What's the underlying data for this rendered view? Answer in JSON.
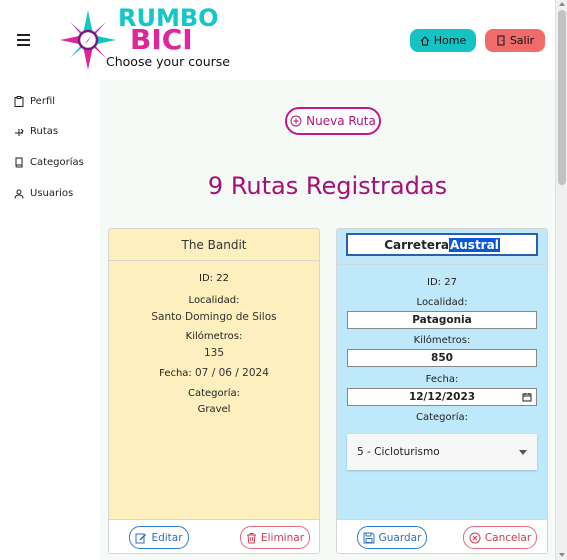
{
  "header": {
    "logo": {
      "word1": "RUMBO",
      "word2": "BICI",
      "tagline": "Choose your course"
    },
    "home_label": "Home",
    "salir_label": "Salir"
  },
  "sidebar": {
    "items": [
      {
        "label": "Perfil",
        "icon": "clipboard-icon"
      },
      {
        "label": "Rutas",
        "icon": "route-icon"
      },
      {
        "label": "Categorías",
        "icon": "book-icon"
      },
      {
        "label": "Usuarios",
        "icon": "user-icon"
      }
    ]
  },
  "main": {
    "new_route_label": "Nueva Ruta",
    "title": "9 Rutas Registradas"
  },
  "cards": [
    {
      "title": "The Bandit",
      "id_text": "ID: 22",
      "localidad_label": "Localidad:",
      "localidad": "Santo Domingo de Silos",
      "km_label": "Kilómetros:",
      "km": "135",
      "fecha_label": "Fecha:",
      "fecha": "07 / 06 / 2024",
      "categoria_label": "Categoría:",
      "categoria": "Gravel",
      "edit_label": "Editar",
      "delete_label": "Eliminar"
    },
    {
      "title_part1": "Carretera ",
      "title_part2": "Austral",
      "id_text": "ID: 27",
      "localidad_label": "Localidad:",
      "localidad": "Patagonia",
      "km_label": "Kilómetros:",
      "km": "850",
      "fecha_label": "Fecha:",
      "fecha": "12/12/2023",
      "categoria_label": "Categoría:",
      "categoria": "5 - Cicloturismo",
      "save_label": "Guardar",
      "cancel_label": "Cancelar"
    }
  ],
  "colors": {
    "accent_teal": "#16c3c3",
    "accent_magenta": "#a50f77",
    "danger": "#f06b6b",
    "card_yellow": "#fdf0be",
    "card_blue": "#bfe8fb"
  }
}
